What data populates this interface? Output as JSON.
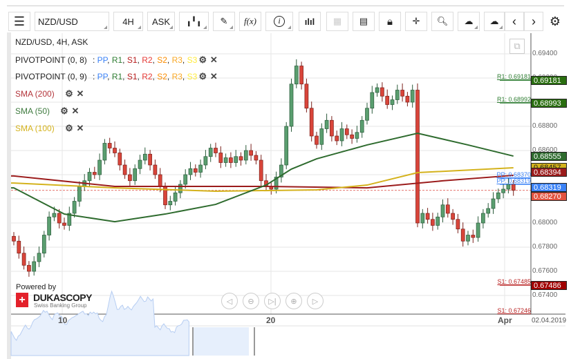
{
  "toolbar": {
    "instrument": "NZD/USD",
    "period": "4H",
    "side": "ASK",
    "fx_label": "f(x)"
  },
  "legend": {
    "title": "NZD/USD, 4H, ASK",
    "pivot1": "PIVOTPOINT (0, 8)",
    "pivot2": "PIVOTPOINT (0, 9)",
    "pivot_items": [
      {
        "t": "PP",
        "c": "#3b82f6"
      },
      {
        "t": "R1",
        "c": "#2e7d32"
      },
      {
        "t": "S1",
        "c": "#b71c1c"
      },
      {
        "t": "R2",
        "c": "#e53935"
      },
      {
        "t": "S2",
        "c": "#fb8c00"
      },
      {
        "t": "R3",
        "c": "#f9a825"
      },
      {
        "t": "S3",
        "c": "#ffeb3b"
      }
    ],
    "sma200": "SMA (200)",
    "sma50": "SMA (50)",
    "sma100": "SMA (100)",
    "colon": ": "
  },
  "branding": {
    "powered": "Powered by",
    "name": "DUKASCOPY",
    "tagline": "Swiss Banking Group"
  },
  "xaxis": {
    "t10": "10",
    "t20": "20",
    "apr": "Apr",
    "date": "02.04.2019"
  },
  "price_axis": [
    "0.69400",
    "0.69200",
    "0.69000",
    "0.68800",
    "0.68600",
    "0.68400",
    "0.68200",
    "0.68000",
    "0.67800",
    "0.67600",
    "0.67400"
  ],
  "badges": {
    "r1a": "0.69181",
    "r1b": "0.68993",
    "sma50": "0.68555",
    "sma100": "0.68457",
    "sma200": "0.68394",
    "pp": "0.68319",
    "last": "0.68270",
    "s1": "0.67486"
  },
  "pivot_labels": {
    "r1a": "R1: 0.69181",
    "r1b": "R1: 0.68992",
    "ppa": "PP: 0.68370",
    "ppb": "PP: 0.68319",
    "s1a": "S1: 0.67485",
    "s1b": "S1: 0.67246"
  },
  "colors": {
    "up": "#5a9e6f",
    "down": "#d9453a",
    "sma50": "#2e6b2e",
    "sma100": "#d4b21c",
    "sma200": "#9b1b1b"
  },
  "chart_data": {
    "type": "candlestick",
    "closes": [
      0.6785,
      0.6775,
      0.6765,
      0.676,
      0.6768,
      0.6775,
      0.679,
      0.6805,
      0.6808,
      0.68,
      0.6798,
      0.6808,
      0.6818,
      0.683,
      0.6835,
      0.6842,
      0.684,
      0.6852,
      0.6866,
      0.6862,
      0.6858,
      0.6848,
      0.684,
      0.6835,
      0.6845,
      0.6852,
      0.6857,
      0.6848,
      0.684,
      0.683,
      0.6815,
      0.6818,
      0.6825,
      0.6832,
      0.684,
      0.6845,
      0.6842,
      0.6848,
      0.6855,
      0.6862,
      0.6858,
      0.685,
      0.6854,
      0.685,
      0.6855,
      0.6852,
      0.686,
      0.6856,
      0.6852,
      0.6835,
      0.683,
      0.6828,
      0.6838,
      0.6848,
      0.688,
      0.6915,
      0.693,
      0.6915,
      0.6895,
      0.6872,
      0.6865,
      0.6878,
      0.6885,
      0.6872,
      0.6868,
      0.6878,
      0.6873,
      0.687,
      0.6875,
      0.6885,
      0.6895,
      0.6908,
      0.6912,
      0.6905,
      0.6898,
      0.6902,
      0.691,
      0.6905,
      0.69,
      0.691,
      0.68,
      0.6808,
      0.6803,
      0.6798,
      0.6805,
      0.6815,
      0.6808,
      0.6803,
      0.6795,
      0.6785,
      0.679,
      0.6788,
      0.68,
      0.6808,
      0.6812,
      0.682,
      0.6825,
      0.6828,
      0.6832,
      0.6827
    ],
    "sma50": [
      [
        0,
        0.68291
      ],
      [
        10,
        0.68074
      ],
      [
        20,
        0.68011
      ],
      [
        30,
        0.68074
      ],
      [
        40,
        0.68154
      ],
      [
        50,
        0.68314
      ],
      [
        55,
        0.68446
      ],
      [
        60,
        0.68531
      ],
      [
        70,
        0.68646
      ],
      [
        80,
        0.68743
      ],
      [
        90,
        0.68646
      ],
      [
        99,
        0.68554
      ]
    ],
    "sma100": [
      [
        0,
        0.68331
      ],
      [
        20,
        0.68291
      ],
      [
        40,
        0.68263
      ],
      [
        60,
        0.68274
      ],
      [
        70,
        0.68314
      ],
      [
        80,
        0.68417
      ],
      [
        99,
        0.68457
      ]
    ],
    "sma200": [
      [
        0,
        0.68389
      ],
      [
        20,
        0.68303
      ],
      [
        50,
        0.68303
      ],
      [
        70,
        0.68291
      ],
      [
        85,
        0.68349
      ],
      [
        99,
        0.68394
      ]
    ],
    "ylim": [
      0.6722,
      0.6958
    ]
  }
}
